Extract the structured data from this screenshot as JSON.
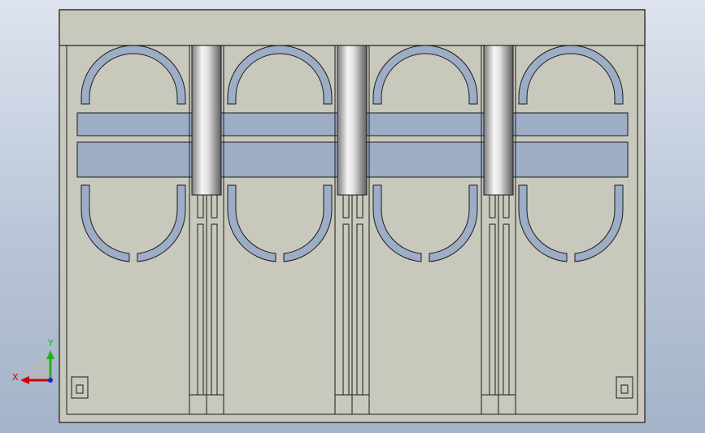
{
  "viewport": {
    "background_top": "#dde3ee",
    "background_bottom": "#a4b3c9"
  },
  "model": {
    "part_color": "#c9c8bc",
    "edge_color": "#1c1c1c",
    "slot_color": "#9eadc6",
    "rod_light": "#f4f4f4",
    "rod_dark": "#6a6a6a",
    "cells": 4,
    "rods": 3
  },
  "triad": {
    "x_label": "X",
    "y_label": "Y",
    "x_color": "#d10000",
    "y_color": "#1fb21f",
    "z_color": "#2222cc"
  }
}
